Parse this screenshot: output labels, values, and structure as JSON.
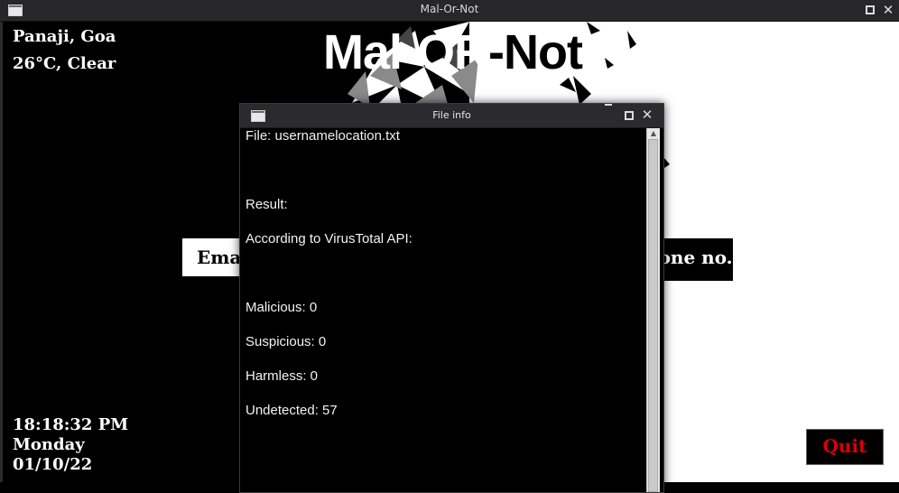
{
  "window": {
    "title": "Mal-Or-Not"
  },
  "weather": {
    "location": "Panaji, Goa",
    "temperature": "26°C, Clear"
  },
  "app_title": {
    "part1": "Mal-",
    "part2": "OR",
    "part3": "-Not"
  },
  "buttons": {
    "email": "Email",
    "phone": "Phone no.",
    "quit": "Quit"
  },
  "clock": {
    "time": "18:18:32 PM",
    "day": "Monday",
    "date": "01/10/22"
  },
  "dialog": {
    "title": "File info",
    "file_line": "File: usernamelocation.txt",
    "result_line": "Result:",
    "source_line": "According to VirusTotal API:",
    "malicious": "Malicious: 0",
    "suspicious": "Suspicious: 0",
    "harmless": "Harmless: 0",
    "undetected": "Undetected: 57"
  },
  "icons": [
    "window-icon",
    "minimize-icon",
    "maximize-icon",
    "close-icon",
    "scroll-up-icon"
  ]
}
